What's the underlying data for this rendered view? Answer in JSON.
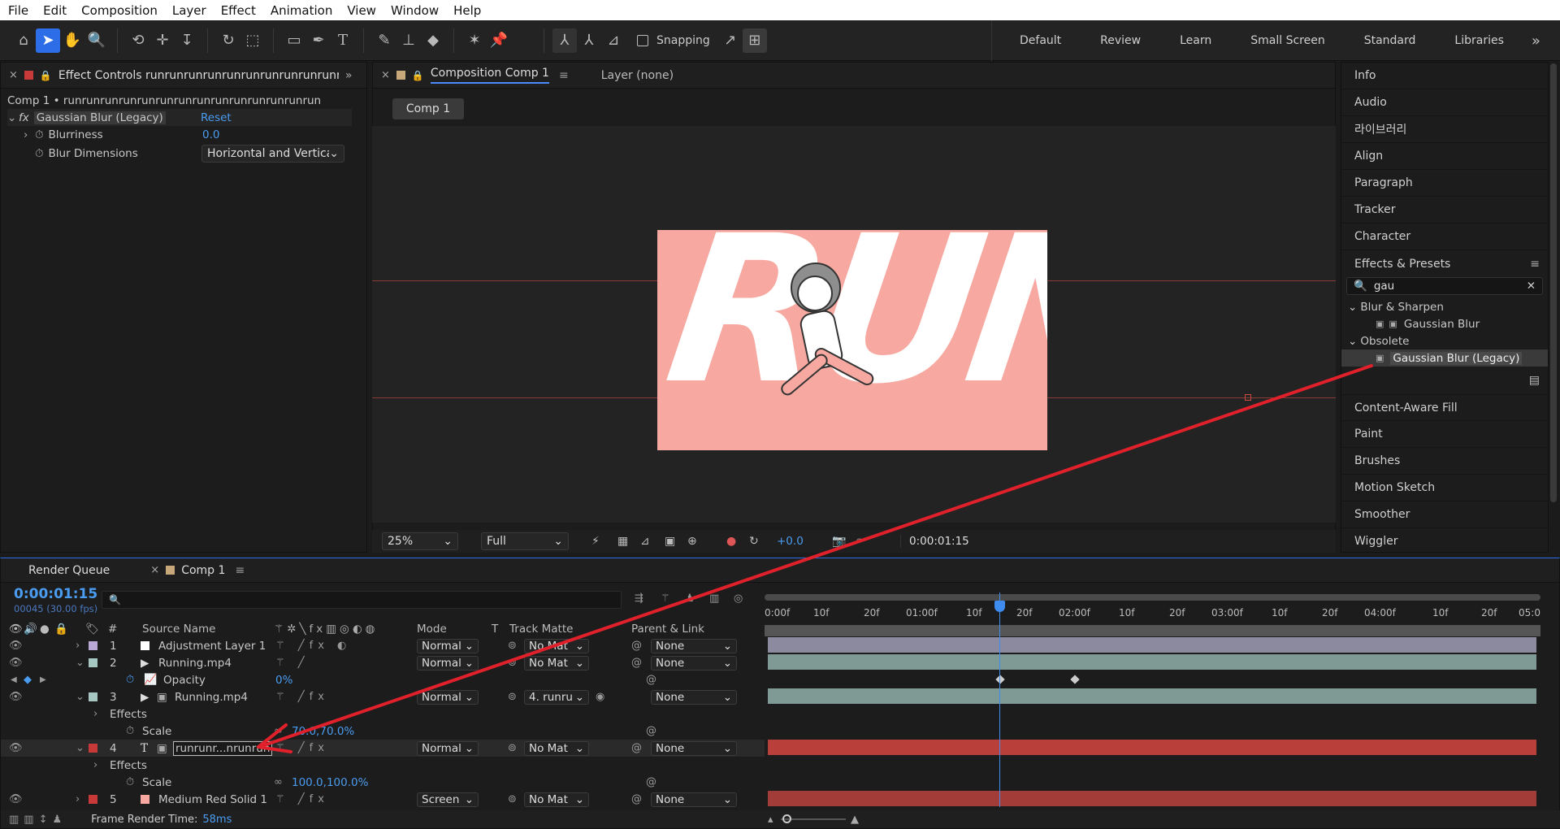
{
  "menu": [
    "File",
    "Edit",
    "Composition",
    "Layer",
    "Effect",
    "Animation",
    "View",
    "Window",
    "Help"
  ],
  "toolbar": {
    "snapping_label": "Snapping"
  },
  "workspaces": [
    "Default",
    "Review",
    "Learn",
    "Small Screen",
    "Standard",
    "Libraries"
  ],
  "effect_controls": {
    "tab_title": "Effect Controls runrunrunrunrunrunrunrunrunrunrunrunrunrunrun",
    "breadcrumb": "Comp 1 • runrunrunrunrunrunrunrunrunrunrunrunrunrun",
    "effect_name": "Gaussian Blur (Legacy)",
    "reset_label": "Reset",
    "blurriness_label": "Blurriness",
    "blurriness_value": "0.0",
    "blur_dim_label": "Blur Dimensions",
    "blur_dim_value": "Horizontal and Vertica"
  },
  "composition": {
    "tab_title": "Composition Comp 1",
    "layer_tab": "Layer (none)",
    "comp_chip": "Comp 1",
    "frame_text": "RUNI",
    "zoom": "25%",
    "resolution": "Full",
    "exposure": "+0.0",
    "timecode": "0:00:01:15"
  },
  "right_panel": {
    "items_top": [
      "Info",
      "Audio",
      "라이브러리",
      "Align",
      "Paragraph",
      "Tracker",
      "Character"
    ],
    "effects_title": "Effects & Presets",
    "search_value": "gau",
    "group1": "Blur & Sharpen",
    "group1_item": "Gaussian Blur",
    "group2": "Obsolete",
    "group2_item": "Gaussian Blur (Legacy)",
    "items_bottom": [
      "Content-Aware Fill",
      "Paint",
      "Brushes",
      "Motion Sketch",
      "Smoother",
      "Wiggler"
    ]
  },
  "timeline": {
    "tab_render": "Render Queue",
    "tab_comp": "Comp 1",
    "timecode": "0:00:01:15",
    "frames": "00045 (30.00 fps)",
    "headers": {
      "source": "Source Name",
      "mode": "Mode",
      "t": "T",
      "track": "Track Matte",
      "parent": "Parent & Link"
    },
    "ruler": [
      "0:00f",
      "10f",
      "20f",
      "01:00f",
      "10f",
      "20f",
      "02:00f",
      "10f",
      "20f",
      "03:00f",
      "10f",
      "20f",
      "04:00f",
      "10f",
      "20f",
      "05:0"
    ],
    "layers": [
      {
        "num": "1",
        "name": "Adjustment Layer 1",
        "mode": "Normal",
        "matte": "No Mat",
        "parent": "None"
      },
      {
        "num": "2",
        "name": "Running.mp4",
        "mode": "Normal",
        "matte": "No Mat",
        "parent": "None"
      },
      {
        "num": "3",
        "name": "Running.mp4",
        "mode": "Normal",
        "matte": "4. runru",
        "parent": "None"
      },
      {
        "num": "4",
        "name": "runrunr...nrunrun",
        "mode": "Normal",
        "matte": "No Mat",
        "parent": "None"
      },
      {
        "num": "5",
        "name": "Medium Red Solid 1",
        "mode": "Screen",
        "matte": "No Mat",
        "parent": "None"
      }
    ],
    "opacity_label": "Opacity",
    "opacity_value": "0%",
    "effects_label": "Effects",
    "scale_label": "Scale",
    "scale3_value": "70.0,70.0%",
    "scale4_value": "100.0,100.0%",
    "render_time_label": "Frame Render Time:",
    "render_time_value": "58ms"
  },
  "colors": {
    "accent": "#2d6ee8",
    "arrow": "#e0202a",
    "pink": "#f7a9a1",
    "red_bar": "#b93f3b"
  }
}
